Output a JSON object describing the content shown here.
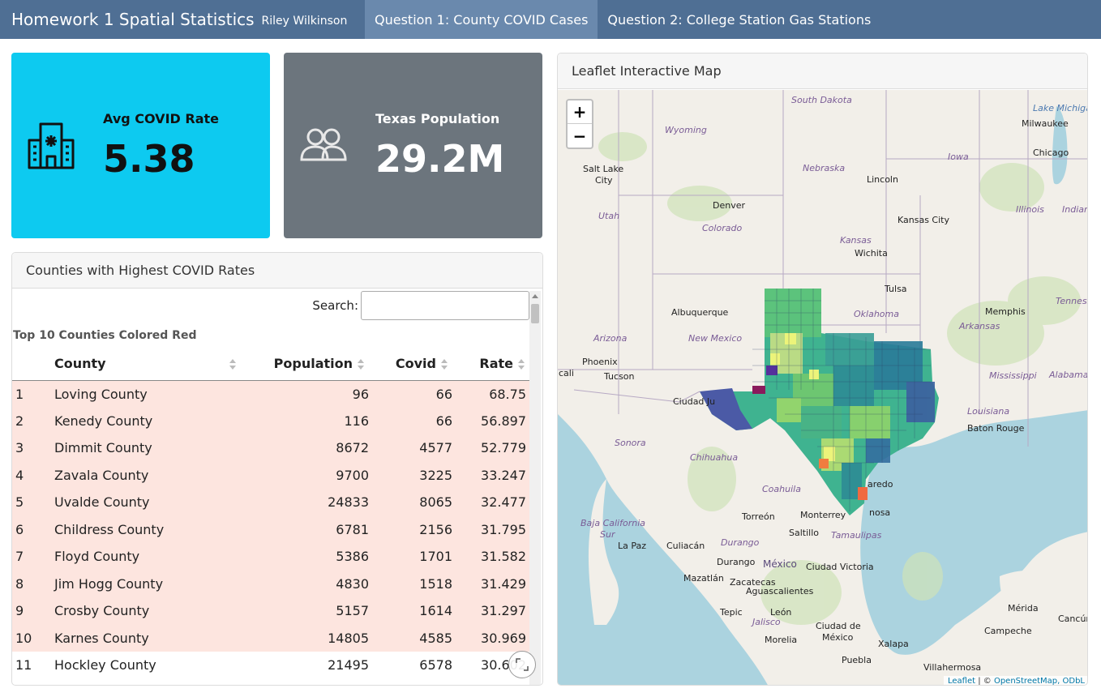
{
  "navbar": {
    "title": "Homework 1 Spatial Statistics",
    "author": "Riley Wilkinson",
    "tabs": [
      {
        "label": "Question 1: County COVID Cases",
        "active": true
      },
      {
        "label": "Question 2: College Station Gas Stations",
        "active": false
      }
    ]
  },
  "value_boxes": [
    {
      "label": "Avg COVID Rate",
      "value": "5.38",
      "icon": "hospital-icon",
      "color": "#0dcaf0"
    },
    {
      "label": "Texas Population",
      "value": "29.2M",
      "icon": "people-icon",
      "color": "#6c757d"
    }
  ],
  "table_card": {
    "header": "Counties with Highest COVID Rates",
    "search_label": "Search:",
    "search_value": "",
    "caption": "Top 10 Counties Colored Red",
    "columns": [
      "",
      "County",
      "Population",
      "Covid",
      "Rate"
    ],
    "rows": [
      {
        "idx": "1",
        "county": "Loving County",
        "population": "96",
        "covid": "66",
        "rate": "68.75"
      },
      {
        "idx": "2",
        "county": "Kenedy County",
        "population": "116",
        "covid": "66",
        "rate": "56.897"
      },
      {
        "idx": "3",
        "county": "Dimmit County",
        "population": "8672",
        "covid": "4577",
        "rate": "52.779"
      },
      {
        "idx": "4",
        "county": "Zavala County",
        "population": "9700",
        "covid": "3225",
        "rate": "33.247"
      },
      {
        "idx": "5",
        "county": "Uvalde County",
        "population": "24833",
        "covid": "8065",
        "rate": "32.477"
      },
      {
        "idx": "6",
        "county": "Childress County",
        "population": "6781",
        "covid": "2156",
        "rate": "31.795"
      },
      {
        "idx": "7",
        "county": "Floyd County",
        "population": "5386",
        "covid": "1701",
        "rate": "31.582"
      },
      {
        "idx": "8",
        "county": "Jim Hogg County",
        "population": "4830",
        "covid": "1518",
        "rate": "31.429"
      },
      {
        "idx": "9",
        "county": "Crosby County",
        "population": "5157",
        "covid": "1614",
        "rate": "31.297"
      },
      {
        "idx": "10",
        "county": "Karnes County",
        "population": "14805",
        "covid": "4585",
        "rate": "30.969"
      },
      {
        "idx": "11",
        "county": "Hockley County",
        "population": "21495",
        "covid": "6578",
        "rate": "30.602"
      }
    ],
    "highlight_color": "#fde5df"
  },
  "map_card": {
    "header": "Leaflet Interactive Map",
    "zoom_in": "+",
    "zoom_out": "−",
    "attribution_leaflet": "Leaflet",
    "attribution_sep": " | © ",
    "attribution_osm": "OpenStreetMap, ODbL",
    "place_labels": {
      "south_dakota": "South Dakota",
      "lake_michigan": "Lake Michigan",
      "milwaukee": "Milwaukee",
      "wyoming": "Wyoming",
      "chicago": "Chicago",
      "iowa": "Iowa",
      "salt_lake": "Salt Lake",
      "city": "City",
      "nebraska": "Nebraska",
      "lincoln": "Lincoln",
      "denver": "Denver",
      "illinois": "Illinois",
      "indiana": "Indian",
      "utah": "Utah",
      "kansas_city": "Kansas City",
      "colorado": "Colorado",
      "kansas": "Kansas",
      "wichita": "Wichita",
      "tulsa": "Tulsa",
      "albuquerque": "Albuquerque",
      "oklahoma": "Oklahoma",
      "memphis": "Memphis",
      "tennessee": "Tennessee",
      "new_mexico": "New Mexico",
      "arizona": "Arizona",
      "arkansas": "Arkansas",
      "phoenix": "Phoenix",
      "tucson": "Tucson",
      "cali": "cali",
      "mississippi": "Mississippi",
      "alabama": "Alabama",
      "ciudad_juarez": "Ciudad Ju",
      "louisiana": "Louisiana",
      "baton_rouge": "Baton Rouge",
      "sonora": "Sonora",
      "chihuahua": "Chihuahua",
      "laredo": "aredo",
      "coahuila": "Coahuila",
      "reynosa": "nosa",
      "torreon": "Torreón",
      "monterrey": "Monterrey",
      "baja": "Baja California",
      "sur": "Sur",
      "saltillo": "Saltillo",
      "tamaulipas": "Tamaulipas",
      "la_paz": "La Paz",
      "culiacan": "Culiacán",
      "durango_r": "Durango",
      "durango": "Durango",
      "mexico": "México",
      "ciudad_victoria": "Ciudad Victoria",
      "mazatlan": "Mazatlán",
      "zacatecas": "Zacatecas",
      "aguascalientes": "Aguascalientes",
      "tepic": "Tepic",
      "leon": "León",
      "jalisco": "Jalisco",
      "merida": "Mérida",
      "cancun": "Cancún",
      "campeche": "Campeche",
      "ciudad_de": "Ciudad de",
      "mexico_city": "México",
      "morelia": "Morelia",
      "xalapa": "Xalapa",
      "puebla": "Puebla",
      "villahermosa": "Villahermosa"
    }
  }
}
